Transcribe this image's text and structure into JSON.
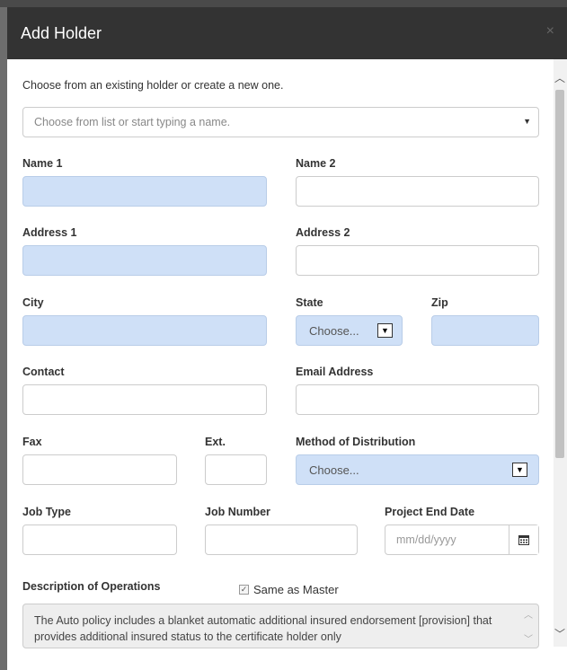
{
  "modal": {
    "title": "Add Holder",
    "close_glyph": "×"
  },
  "intro_text": "Choose from an existing holder or create a new one.",
  "holder_select": {
    "placeholder": "Choose from list or start typing a name."
  },
  "fields": {
    "name1_label": "Name 1",
    "name2_label": "Name 2",
    "address1_label": "Address 1",
    "address2_label": "Address 2",
    "city_label": "City",
    "state_label": "State",
    "zip_label": "Zip",
    "contact_label": "Contact",
    "email_label": "Email Address",
    "fax_label": "Fax",
    "ext_label": "Ext.",
    "method_label": "Method of Distribution",
    "job_type_label": "Job Type",
    "job_number_label": "Job Number",
    "project_end_label": "Project End Date",
    "description_label": "Description of Operations"
  },
  "state_select": {
    "value": "Choose..."
  },
  "method_select": {
    "value": "Choose..."
  },
  "project_end_date": {
    "placeholder": "mm/dd/yyyy"
  },
  "same_as_master": {
    "label": "Same as Master",
    "checked": true
  },
  "description_text": "The Auto policy includes a blanket automatic additional insured endorsement [provision] that provides additional insured status to the certificate holder only",
  "colors": {
    "header": "#333333",
    "required_field": "#cfe0f7"
  }
}
